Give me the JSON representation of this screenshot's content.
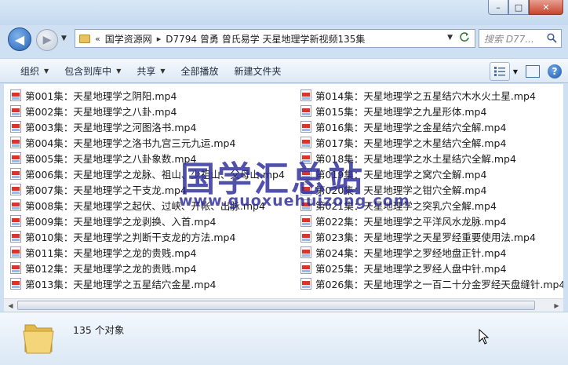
{
  "window": {
    "minimize_glyph": "–",
    "maximize_glyph": "□",
    "close_glyph": "✕"
  },
  "nav": {
    "back_glyph": "◀",
    "forward_glyph": "▶",
    "history_glyph": "▼",
    "breadcrumb_lead": "«",
    "breadcrumb": [
      "国学资源网",
      "D7794 曾勇 曾氏易学 天星地理学新视频135集"
    ],
    "breadcrumb_sep": "▸",
    "search_placeholder": "搜索 D77..."
  },
  "toolbar": {
    "organize": "组织",
    "include_in_library": "包含到库中",
    "share": "共享",
    "play_all": "全部播放",
    "new_folder": "新建文件夹"
  },
  "files_left": [
    "第001集：天星地理学之阴阳.mp4",
    "第002集：天星地理学之八卦.mp4",
    "第003集：天星地理学之河图洛书.mp4",
    "第004集：天星地理学之洛书九宫三元九运.mp4",
    "第005集：天星地理学之八卦象数.mp4",
    "第006集：天星地理学之龙脉、祖山、少祖山、父母山.mp4",
    "第007集：天星地理学之干支龙.mp4",
    "第008集：天星地理学之起伏、过峡、开帐、出脉.mp4",
    "第009集：天星地理学之龙剥换、入首.mp4",
    "第010集：天星地理学之判断干支龙的方法.mp4",
    "第011集：天星地理学之龙的贵贱.mp4",
    "第012集：天星地理学之龙的贵贱.mp4",
    "第013集：天星地理学之五星结穴金星.mp4"
  ],
  "files_right": [
    "第014集：天星地理学之五星结穴木水火土星.mp4",
    "第015集：天星地理学之九星形体.mp4",
    "第016集：天星地理学之金星结穴全解.mp4",
    "第017集：天星地理学之木星结穴全解.mp4",
    "第018集：天星地理学之水土星结穴全解.mp4",
    "第019集：天星地理学之窝穴全解.mp4",
    "第020集：天星地理学之钳穴全解.mp4",
    "第021集：天星地理学之突乳穴全解.mp4",
    "第022集：天星地理学之平洋风水龙脉.mp4",
    "第023集：天星地理学之天星罗经重要使用法.mp4",
    "第024集：天星地理学之罗经地盘正针.mp4",
    "第025集：天星地理学之罗经人盘中针.mp4",
    "第026集：天星地理学之一百二十分金罗经天盘缝针.mp4"
  ],
  "status": {
    "count": "135 个对象"
  },
  "watermark": {
    "cn": "国学汇总站",
    "url": "www.guoxuehuizong.com"
  },
  "colors": {
    "watermark": "#2c2c9a",
    "chrome": "#cfe0f2"
  }
}
